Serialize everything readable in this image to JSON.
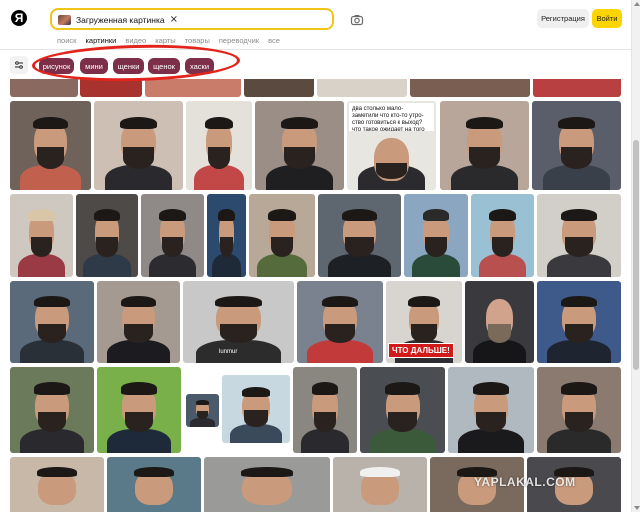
{
  "header": {
    "logo": "Я",
    "search_chip_label": "Загруженная картинка",
    "search_chip_close": "×",
    "register_label": "Регистрация",
    "login_label": "Войти"
  },
  "tabs": [
    "поиск",
    "картинки",
    "видео",
    "карты",
    "товары",
    "переводчик",
    "все"
  ],
  "active_tab": "картинки",
  "filters": [
    "рисунок",
    "мини",
    "щенки",
    "щенок",
    "хаски"
  ],
  "photo_captions": {
    "text_card": "два столько мало- заметили что кто-то утро-ство готовиться к выход? что такое ожидает на того что я пол. что у нас меня",
    "banner": "ЧТО ДАЛЬШЕ!",
    "shirt": "lunmur"
  },
  "watermark": "YAPLAKAL.COM",
  "colors": {
    "accent_yellow": "#fcd400",
    "filter_pill": "#7d2f4a",
    "annotation_red": "#e3241c"
  },
  "icons": [
    "yandex-logo",
    "close-icon",
    "camera-icon",
    "sliders-icon"
  ]
}
